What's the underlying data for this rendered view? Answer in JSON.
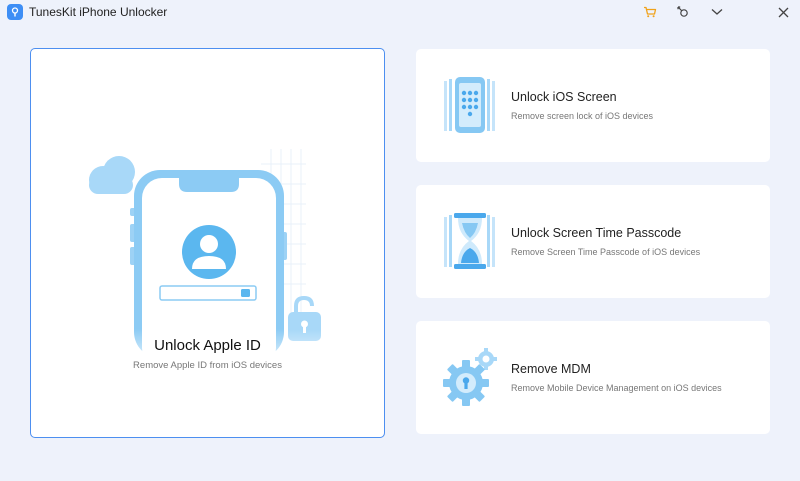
{
  "window": {
    "title": "TunesKit iPhone Unlocker",
    "controls": [
      "cart-icon",
      "register-key-icon",
      "menu-chevron-icon",
      "close-icon"
    ]
  },
  "colors": {
    "accent": "#4d8ff0",
    "cart": "#f0a21a",
    "background": "#eef2fb",
    "card": "#ffffff",
    "illustration": "#7cc3f4"
  },
  "main_card": {
    "title": "Unlock Apple ID",
    "description": "Remove Apple ID from iOS devices"
  },
  "features": [
    {
      "title": "Unlock iOS Screen",
      "description": "Remove screen lock of iOS devices",
      "icon": "phone-keypad-icon"
    },
    {
      "title": "Unlock Screen Time Passcode",
      "description": "Remove Screen Time Passcode of iOS devices",
      "icon": "hourglass-icon"
    },
    {
      "title": "Remove MDM",
      "description": "Remove Mobile Device Management on iOS devices",
      "icon": "gear-lock-icon"
    }
  ]
}
